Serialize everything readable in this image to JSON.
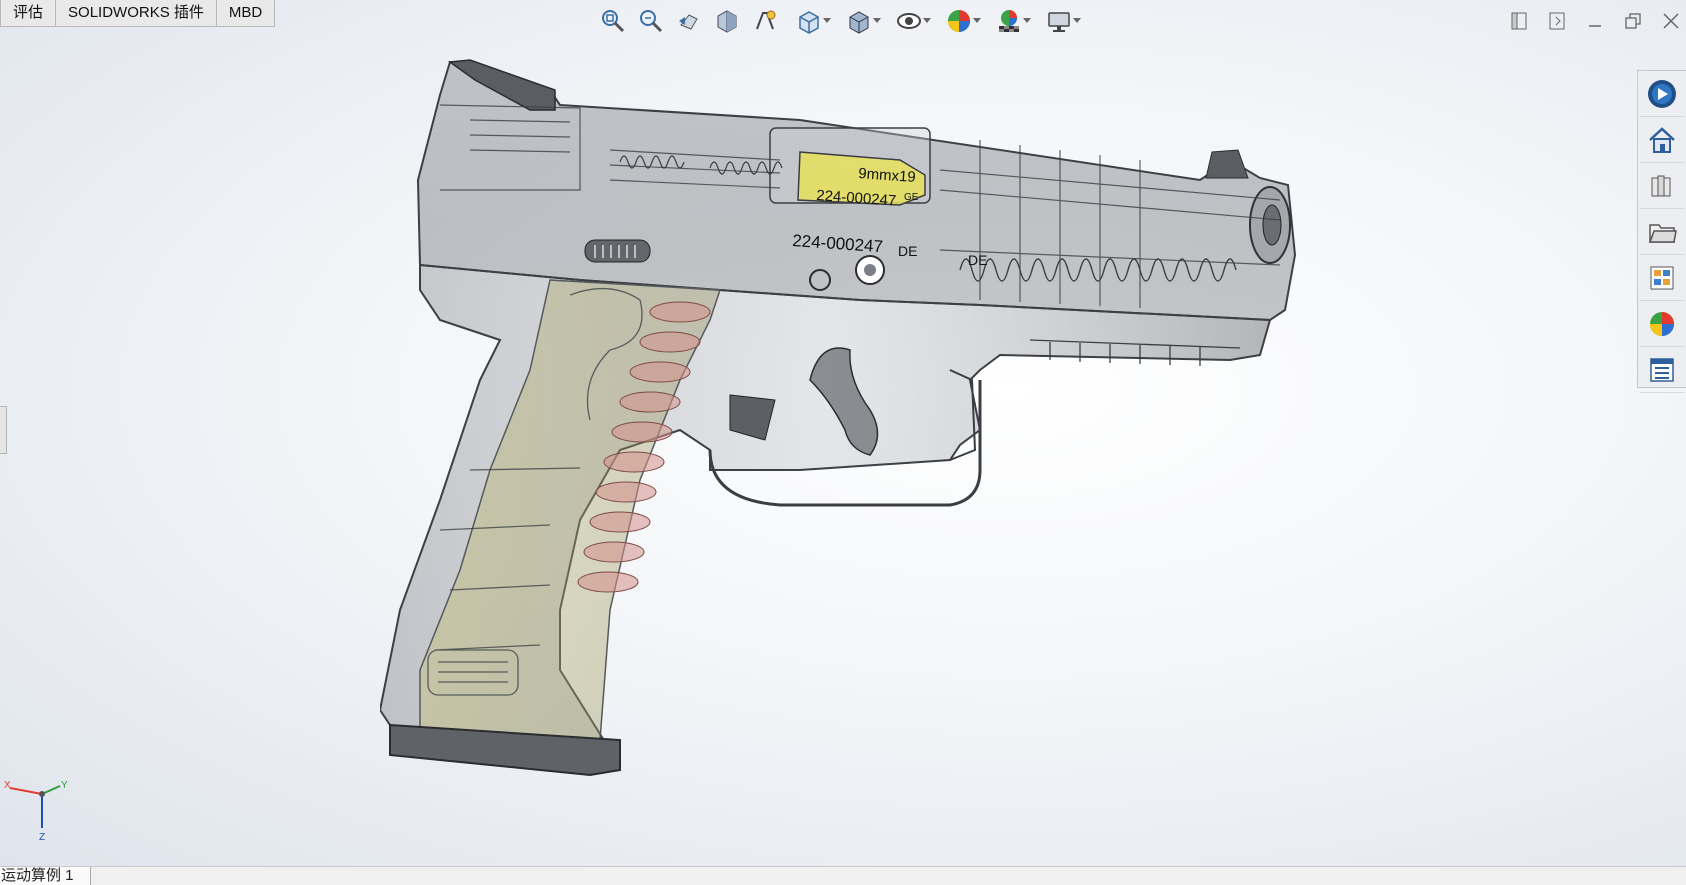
{
  "tabs": [
    "评估",
    "SOLIDWORKS 插件",
    "MBD"
  ],
  "hud_icons": [
    "zoom-to-fit-icon",
    "zoom-to-area-icon",
    "previous-view-icon",
    "section-view-icon",
    "dynamic-annotation-icon",
    "view-orientation-icon",
    "display-style-icon",
    "hide-show-items-icon",
    "edit-appearance-icon",
    "apply-scene-icon",
    "view-settings-icon"
  ],
  "window_controls": [
    "tile-left-icon",
    "tile-right-icon",
    "minimize-icon",
    "restore-icon",
    "close-icon"
  ],
  "task_pane_icons": [
    "solidworks-resources-icon",
    "home-icon",
    "design-library-icon",
    "file-explorer-icon",
    "view-palette-icon",
    "appearances-scenes-icon",
    "custom-properties-icon"
  ],
  "model": {
    "chamber_label_1": "9mmx19",
    "chamber_label_2": "224-000247",
    "chamber_label_3": "GE",
    "frame_label": "224-000247",
    "frame_label_2": "DE",
    "frame_label_3": "DE"
  },
  "triad": {
    "x": "X",
    "y": "Y",
    "z": "Z"
  },
  "status": {
    "tab_label": "运动算例 1"
  },
  "colors": {
    "accent": "#1f5fa8",
    "viewport_bg": "#eef1f5",
    "model_grey": "#6b6e73",
    "cartridge_yellow": "#e8e05a"
  }
}
